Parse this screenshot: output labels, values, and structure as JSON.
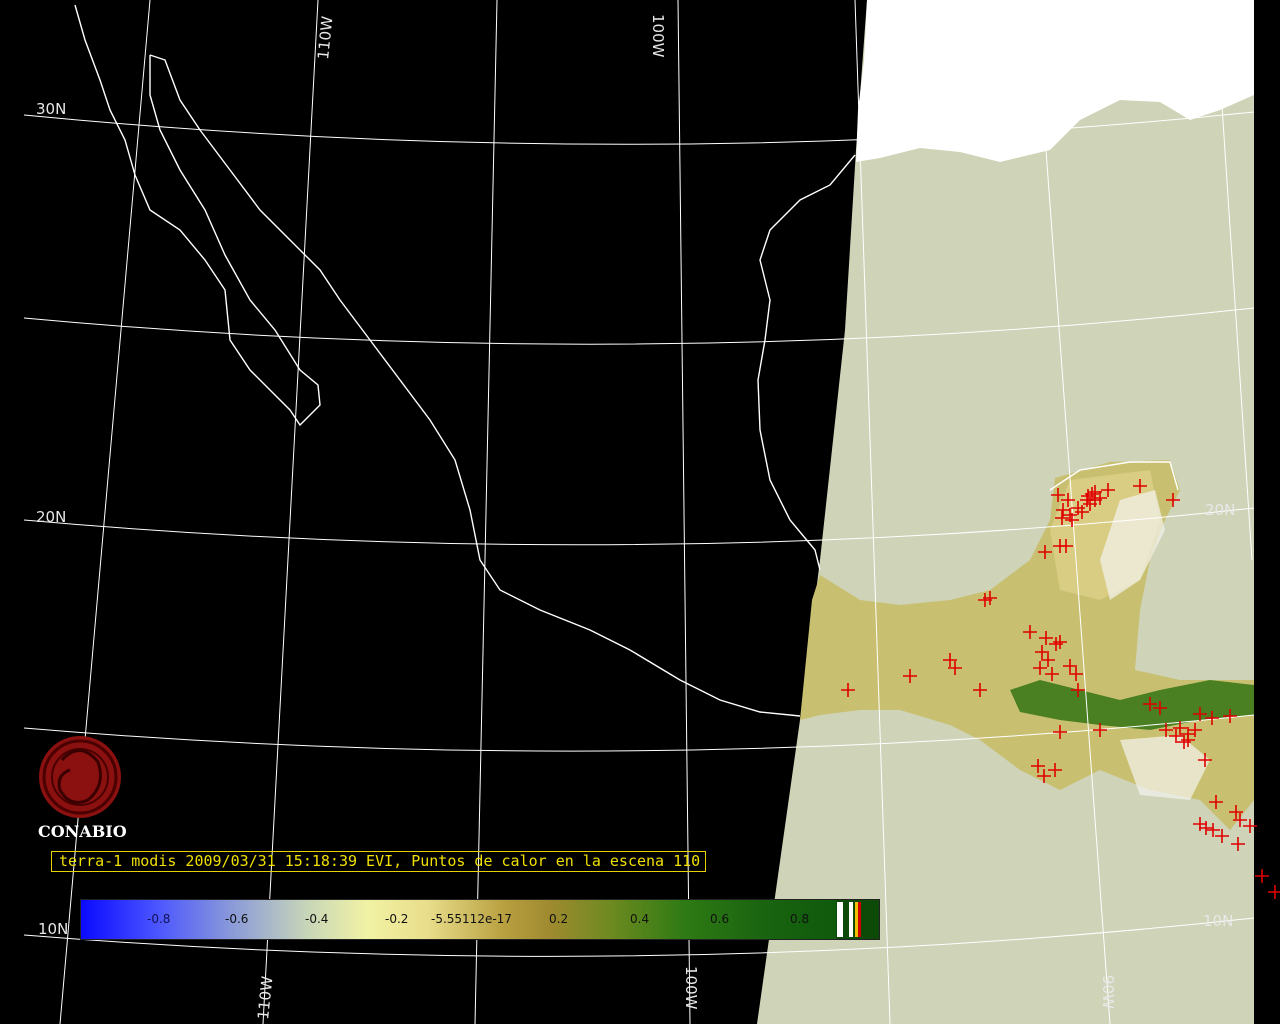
{
  "map": {
    "grid_labels": {
      "lat_30n": "30N",
      "lat_20n_left": "20N",
      "lat_20n_right": "20N",
      "lat_10n_left": "10N",
      "lat_10n_right": "10N",
      "lon_110w_top": "110W",
      "lon_100w_top": "100W",
      "lon_110w_bottom": "110W",
      "lon_100w_bottom": "100W",
      "lon_90w_bottom": "90W"
    },
    "colors": {
      "background": "#000000",
      "land_no_data": "#cfd3b7",
      "coastline": "#ffffff",
      "graticule": "#ffffff",
      "hotspot": "#e00000",
      "cloud": "#ffffff"
    },
    "hotspot_marker": "red-cross",
    "hotspot_count_visible": 68
  },
  "logo": {
    "name": "CONABIO"
  },
  "title": "terra-1 modis 2009/03/31 15:18:39 EVI, Puntos de calor en la escena 110",
  "colorbar": {
    "ticks": [
      "-0.8",
      "-0.6",
      "-0.4",
      "-0.2",
      "-5.55112e-17",
      "0.2",
      "0.4",
      "0.6",
      "0.8"
    ],
    "range": [
      -1,
      1
    ],
    "low_color": "#0a0aff",
    "high_color": "#0f5a0c",
    "extra_classes": [
      "#ffffff",
      "#ffffff",
      "#f0c000",
      "#d00000"
    ]
  }
}
